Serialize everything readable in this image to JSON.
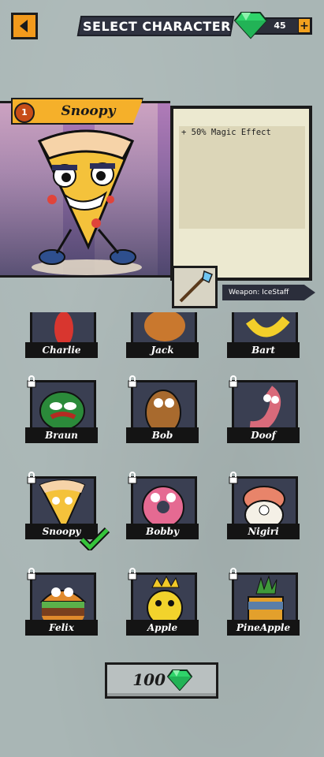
{
  "header": {
    "title": "SELECT CHARACTER",
    "gem_count": "45",
    "plus_label": "+"
  },
  "selected": {
    "level": "1",
    "name": "Snoopy",
    "description": "+ 50% Magic Effect",
    "weapon_label": "Weapon: IceStaff"
  },
  "characters": [
    {
      "name": "Charlie"
    },
    {
      "name": "Jack"
    },
    {
      "name": "Bart"
    },
    {
      "name": "Braun"
    },
    {
      "name": "Bob"
    },
    {
      "name": "Doof"
    },
    {
      "name": "Snoopy"
    },
    {
      "name": "Bobby"
    },
    {
      "name": "Nigiri"
    },
    {
      "name": "Felix"
    },
    {
      "name": "Apple"
    },
    {
      "name": "PineApple"
    }
  ],
  "buy": {
    "price": "100"
  },
  "colors": {
    "accent": "#f5b02a",
    "gem": "#2fd46a",
    "check": "#35c43b"
  }
}
